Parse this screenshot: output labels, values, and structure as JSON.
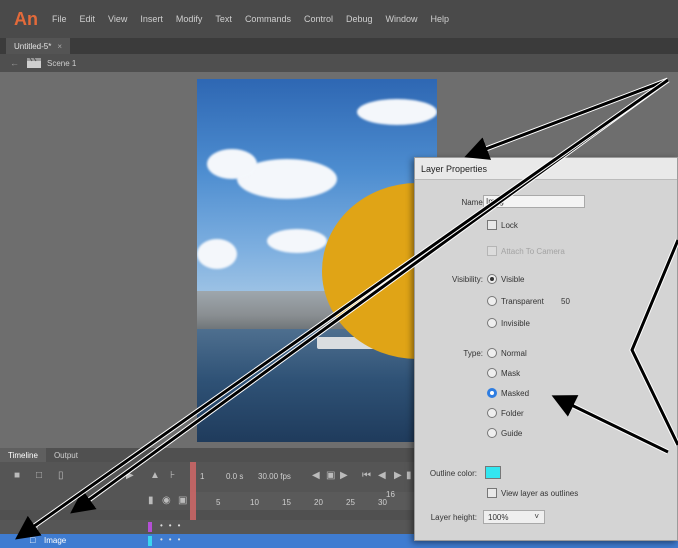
{
  "app": {
    "logo": "An"
  },
  "menu": [
    "File",
    "Edit",
    "View",
    "Insert",
    "Modify",
    "Text",
    "Commands",
    "Control",
    "Debug",
    "Window",
    "Help"
  ],
  "document_tab": {
    "title": "Untitled-5*",
    "close": "×"
  },
  "scene": {
    "label": "Scene 1"
  },
  "timeline": {
    "tabs": [
      "Timeline",
      "Output"
    ],
    "frame": "1",
    "time": "0.0 s",
    "fps": "30.00 fps",
    "frame_marker": "16",
    "ruler": [
      "5",
      "10",
      "15",
      "20",
      "25",
      "30"
    ],
    "layers": [
      {
        "name": "",
        "swatch": "#b44fd6"
      },
      {
        "name": "Image",
        "swatch": "#3ad6f0"
      }
    ]
  },
  "dialog": {
    "title": "Layer Properties",
    "name_label": "Name:",
    "name_value": "Imag",
    "lock_label": "Lock",
    "attach_camera_label": "Attach To Camera",
    "visibility_label": "Visibility:",
    "visible_label": "Visible",
    "transparent_label": "Transparent",
    "transparent_value": "50",
    "invisible_label": "Invisible",
    "type_label": "Type:",
    "type_options": [
      "Normal",
      "Mask",
      "Masked",
      "Folder",
      "Guide"
    ],
    "type_selected": "Masked",
    "outline_color_label": "Outline color:",
    "outline_color": "#33e6f0",
    "view_outlines_label": "View layer as outlines",
    "layer_height_label": "Layer height:",
    "layer_height_value": "100%"
  },
  "colors": {
    "ellipse": "#e0a416",
    "accent_blue": "#2f7de1",
    "menubar": "#4a4a4a"
  }
}
